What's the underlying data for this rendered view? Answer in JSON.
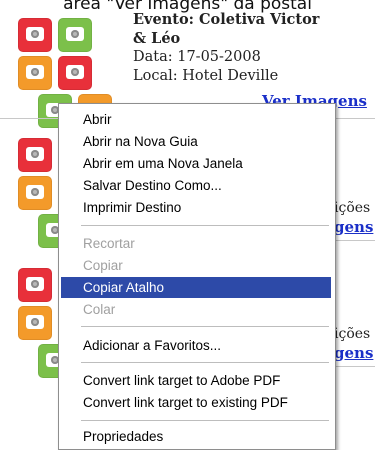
{
  "caption": "área \"Ver Imagens\" da postal",
  "event": {
    "title_line1": "Evento: Coletiva Victor",
    "title_line2": "& Léo",
    "date": "Data: 17-05-2008",
    "location": "Local: Hotel Deville",
    "link": "Ver Imagens"
  },
  "partials": {
    "row2_text": "ições",
    "row2_link": "gens",
    "row3_text": "ições",
    "row3_link": "gens"
  },
  "context_menu": {
    "items": [
      {
        "label": "Abrir",
        "state": "enabled"
      },
      {
        "label": "Abrir na Nova Guia",
        "state": "enabled"
      },
      {
        "label": "Abrir em uma Nova Janela",
        "state": "enabled"
      },
      {
        "label": "Salvar Destino Como...",
        "state": "enabled"
      },
      {
        "label": "Imprimir Destino",
        "state": "enabled"
      },
      {
        "label": "Recortar",
        "state": "disabled"
      },
      {
        "label": "Copiar",
        "state": "disabled"
      },
      {
        "label": "Copiar Atalho",
        "state": "selected"
      },
      {
        "label": "Colar",
        "state": "disabled"
      },
      {
        "label": "Adicionar a Favoritos...",
        "state": "enabled"
      },
      {
        "label": "Convert link target to Adobe PDF",
        "state": "enabled"
      },
      {
        "label": "Convert link target to existing PDF",
        "state": "enabled"
      },
      {
        "label": "Propriedades",
        "state": "enabled"
      }
    ]
  },
  "colors": {
    "tile_red": "#e8303a",
    "tile_green": "#7cc04a",
    "tile_orange": "#f39a2a",
    "link": "#1a2fc8",
    "menu_highlight": "#2d4aa8"
  }
}
